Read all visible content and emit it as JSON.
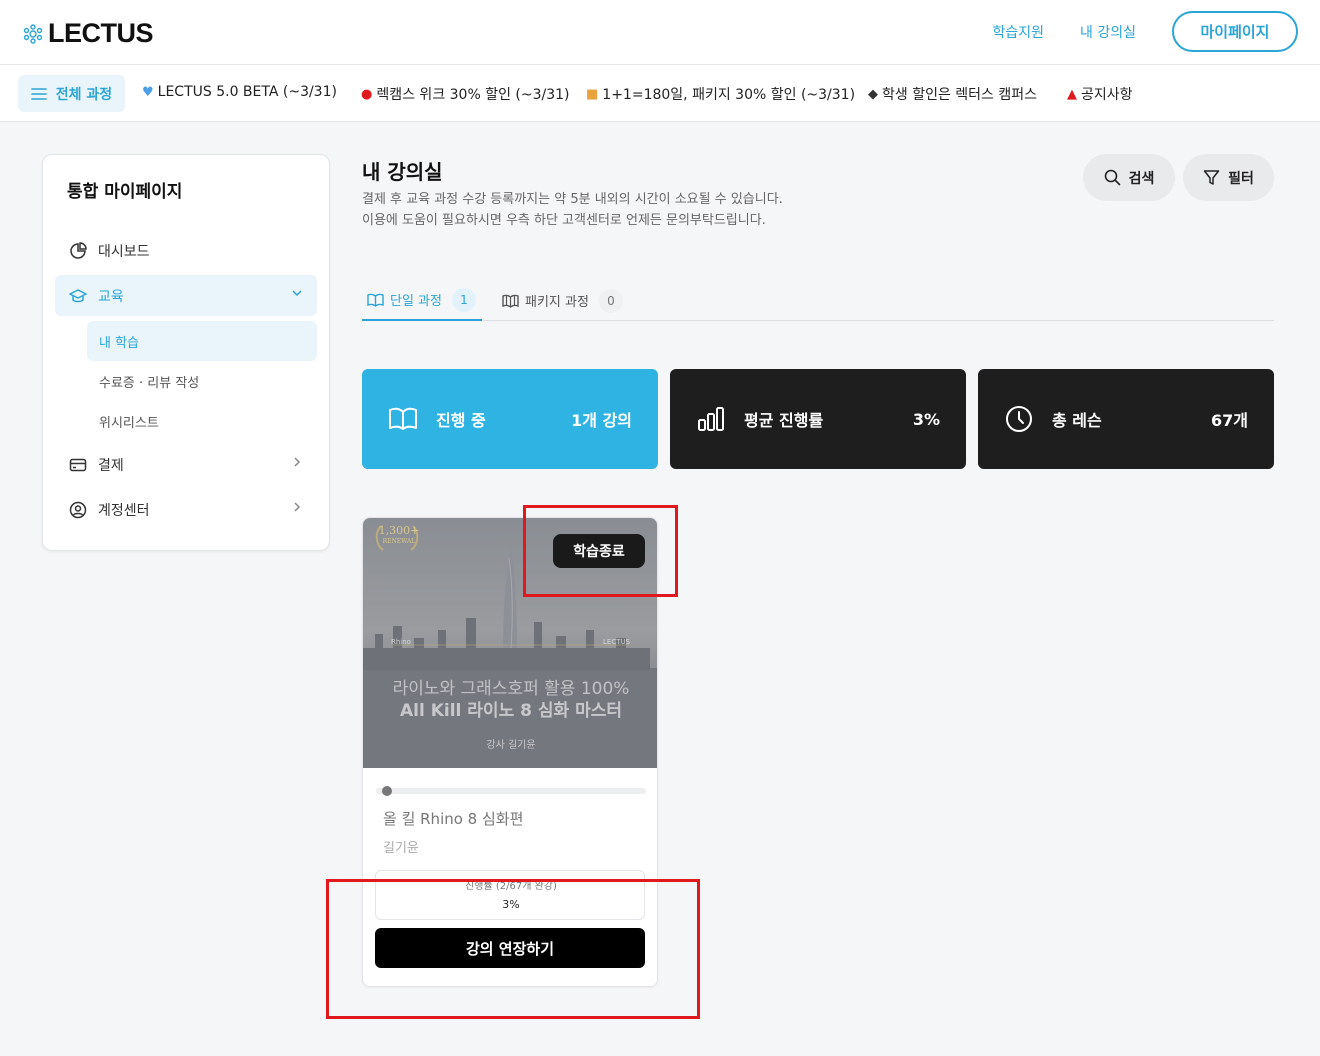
{
  "header": {
    "logo": "LECTUS",
    "nav": [
      "학습지원",
      "내 강의실"
    ],
    "mypage_label": "마이페이지"
  },
  "promobar": {
    "all_courses": "전체 과정",
    "items": [
      {
        "icon": "blue-heart-icon",
        "label": "LECTUS 5.0 BETA (~3/31)"
      },
      {
        "icon": "red-pin-icon",
        "label": "렉캠스 위크 30% 할인 (~3/31)"
      },
      {
        "icon": "gift-icon",
        "label": "1+1=180일, 패키지 30% 할인 (~3/31)"
      },
      {
        "icon": "graduation-cap-icon",
        "label": "학생 할인은 렉터스 캠퍼스"
      },
      {
        "icon": "megaphone-icon",
        "label": "공지사항"
      }
    ]
  },
  "sidebar": {
    "title": "통합 마이페이지",
    "items": [
      {
        "label": "대시보드",
        "icon": "pie-chart-icon"
      },
      {
        "label": "교육",
        "icon": "graduation-cap-icon"
      },
      {
        "label": "결제",
        "icon": "card-icon"
      },
      {
        "label": "계정센터",
        "icon": "user-circle-icon"
      }
    ],
    "sub_items": [
      "내 학습",
      "수료증 · 리뷰 작성",
      "위시리스트"
    ]
  },
  "main": {
    "title": "내 강의실",
    "desc_line1": "결제 후 교육 과정 수강 등록까지는 약 5분 내외의 시간이 소요될 수 있습니다.",
    "desc_line2": "이용에 도움이 필요하시면 우측 하단 고객센터로 언제든 문의부탁드립니다.",
    "search_label": "검색",
    "filter_label": "필터",
    "tabs": [
      {
        "label": "단일 과정",
        "count": "1"
      },
      {
        "label": "패키지 과정",
        "count": "0"
      }
    ],
    "stats": [
      {
        "label": "진행 중",
        "value": "1개 강의",
        "color": "#2fb3e3"
      },
      {
        "label": "평균 진행률",
        "value": "3%",
        "color": "#1e1e1e"
      },
      {
        "label": "총 레슨",
        "value": "67개",
        "color": "#1e1e1e"
      }
    ]
  },
  "course": {
    "status_badge": "학습종료",
    "thumb_badge": "1,300+",
    "thumb_badge_sub": "RENEWAL",
    "thumb_left_small": "Rhino",
    "thumb_right_small": "LECTUS",
    "thumb_sub": "라이노와 그래스호퍼 활용 100%",
    "thumb_main": "All Kill 라이노 8 심화 마스터",
    "thumb_author": "강사 길기윤",
    "title": "올 킬 Rhino 8 심화편",
    "author": "길기윤",
    "progress_label": "진행률 (2/67개 완강)",
    "progress_value": "3%",
    "progress_fraction": 0.03,
    "extend_label": "강의 연장하기"
  }
}
